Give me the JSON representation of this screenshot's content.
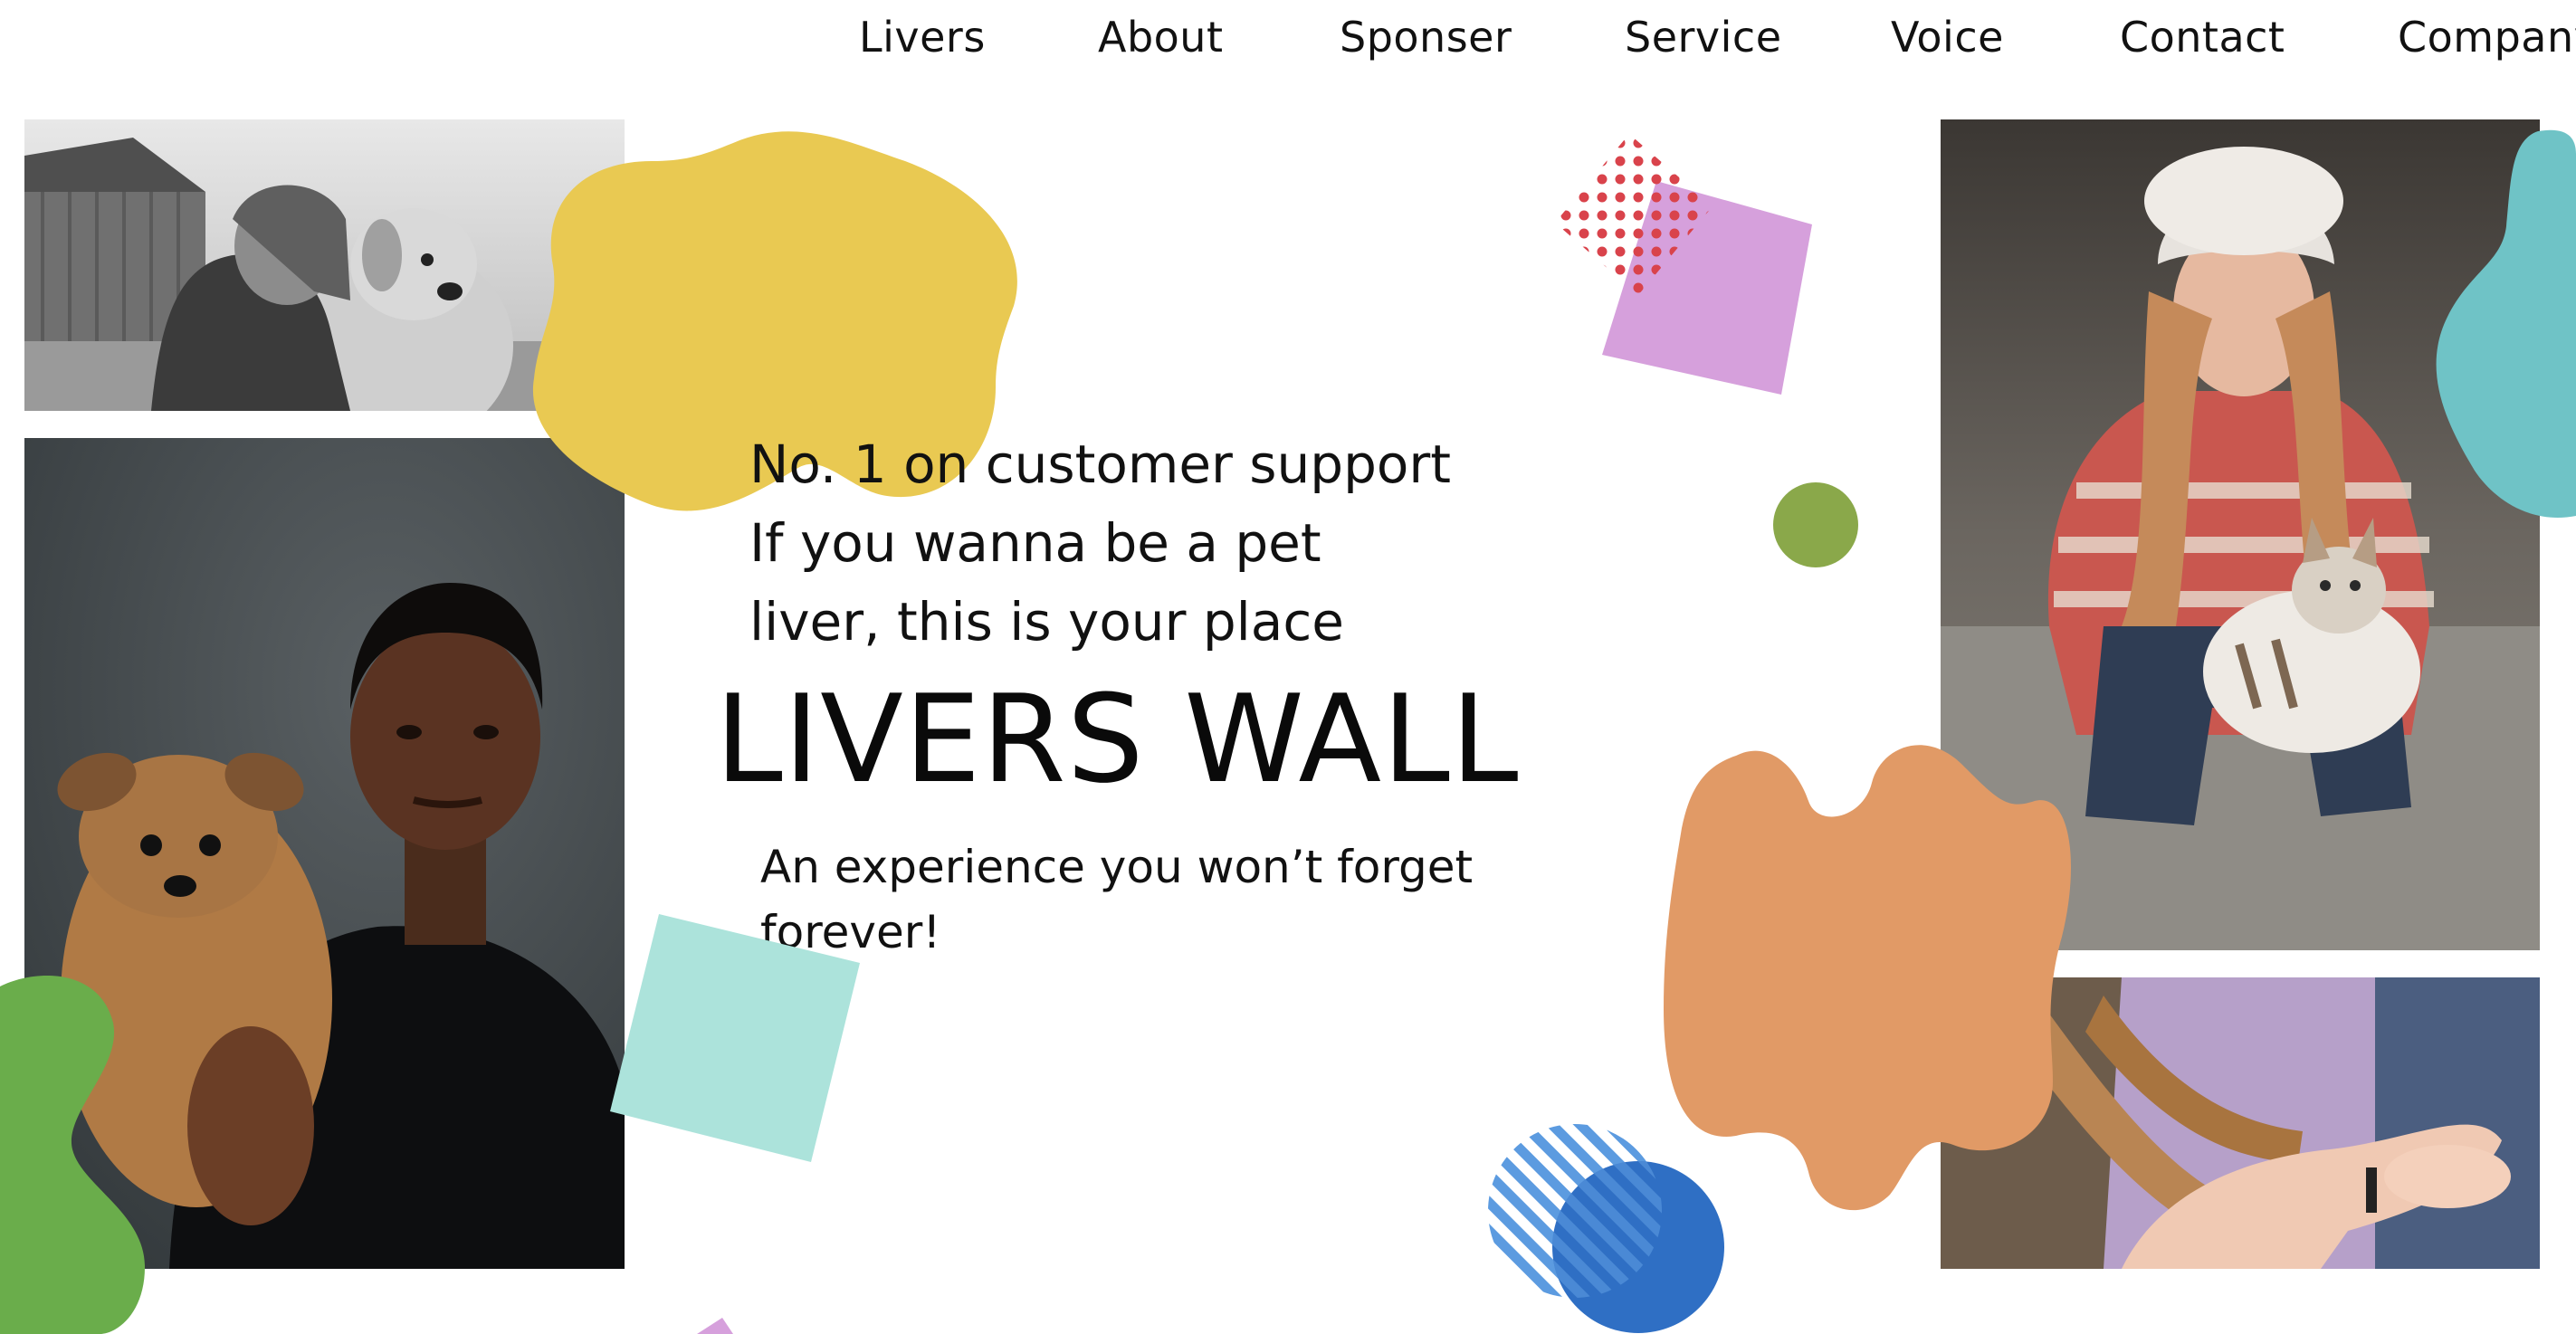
{
  "nav": {
    "items": [
      {
        "key": "livers",
        "label": "Livers"
      },
      {
        "key": "about",
        "label": "About"
      },
      {
        "key": "sponser",
        "label": "Sponser"
      },
      {
        "key": "service",
        "label": "Service"
      },
      {
        "key": "voice",
        "label": "Voice"
      },
      {
        "key": "contact",
        "label": "Contact"
      },
      {
        "key": "company",
        "label": "Company"
      }
    ]
  },
  "hero": {
    "lines": [
      "No. 1 on customer support",
      "If you wanna be a pet",
      "liver, this is your place"
    ],
    "title": "LIVERS WALL",
    "subtitle_lines": [
      "An experience you won’t forget",
      "forever!"
    ]
  },
  "colors": {
    "yellow_blob": "#e9c952",
    "purple_square": "#d6a0dc",
    "red_dots": "#d9434b",
    "olive_dot": "#8aa84a",
    "teal_blob": "#6fc3c6",
    "orange_blob": "#e19a66",
    "mint_square": "#ace3db",
    "green_blob": "#6aad4b",
    "blue_circle": "#2f6fc4",
    "stripe_blue": "#5c9be0"
  }
}
